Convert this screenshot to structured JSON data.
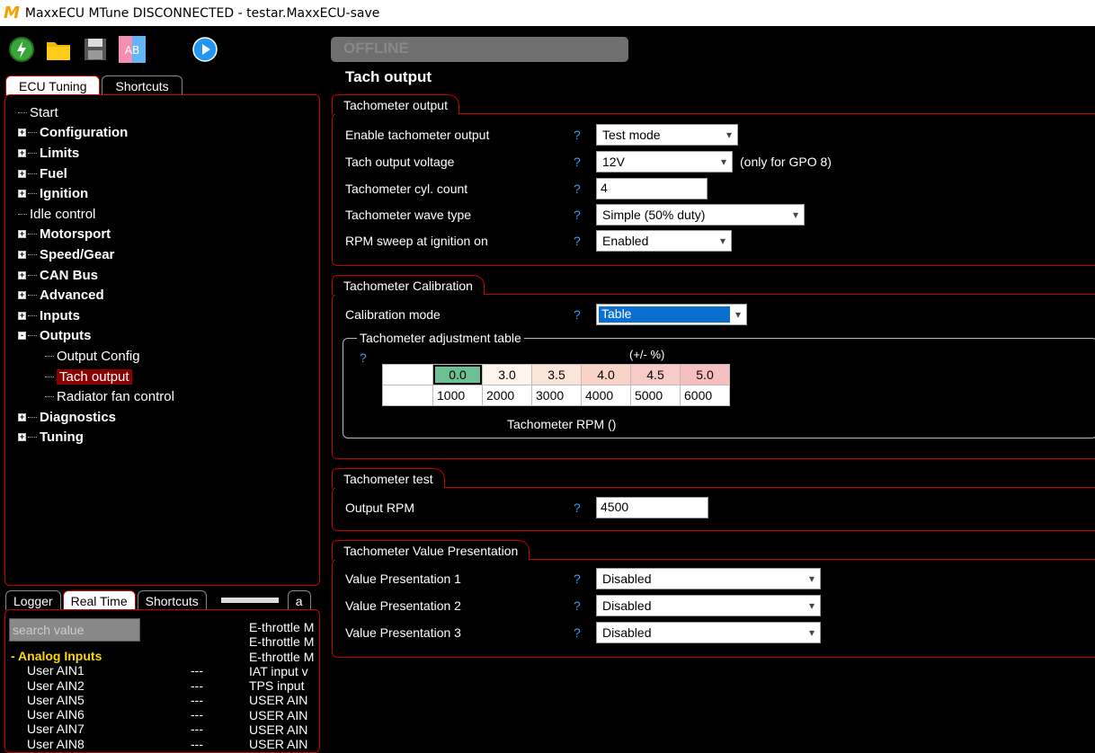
{
  "window": {
    "title": "MaxxECU MTune DISCONNECTED - testar.MaxxECU-save",
    "logo": "M"
  },
  "toolbar": {
    "icons": [
      "power-icon",
      "folder-icon",
      "save-icon",
      "compare-icon",
      "play-icon"
    ],
    "compare_label": "AB"
  },
  "left_tabs": [
    "ECU Tuning",
    "Shortcuts"
  ],
  "tree": [
    {
      "label": "Start",
      "bold": false,
      "expander": ""
    },
    {
      "label": "Configuration",
      "bold": true,
      "expander": "+"
    },
    {
      "label": "Limits",
      "bold": true,
      "expander": "+"
    },
    {
      "label": "Fuel",
      "bold": true,
      "expander": "+"
    },
    {
      "label": "Ignition",
      "bold": true,
      "expander": "+"
    },
    {
      "label": "Idle control",
      "bold": false,
      "expander": ""
    },
    {
      "label": "Motorsport",
      "bold": true,
      "expander": "+"
    },
    {
      "label": "Speed/Gear",
      "bold": true,
      "expander": "+"
    },
    {
      "label": "CAN Bus",
      "bold": true,
      "expander": "+"
    },
    {
      "label": "Advanced",
      "bold": true,
      "expander": "+"
    },
    {
      "label": "Inputs",
      "bold": true,
      "expander": "+"
    },
    {
      "label": "Outputs",
      "bold": true,
      "expander": "-"
    },
    {
      "label": "Output Config",
      "bold": false,
      "expander": "",
      "child": true
    },
    {
      "label": "Tach output",
      "bold": false,
      "expander": "",
      "child": true,
      "selected": true
    },
    {
      "label": "Radiator fan control",
      "bold": false,
      "expander": "",
      "child": true
    },
    {
      "label": "Diagnostics",
      "bold": true,
      "expander": "+"
    },
    {
      "label": "Tuning",
      "bold": true,
      "expander": "+"
    }
  ],
  "bottom_tabs": [
    "Logger",
    "Real Time",
    "Shortcuts",
    "a"
  ],
  "search": {
    "placeholder": "search value"
  },
  "realtime": {
    "group": "- Analog Inputs",
    "rows": [
      {
        "name": "User AIN1",
        "value": "---"
      },
      {
        "name": "User AIN2",
        "value": "---"
      },
      {
        "name": "User AIN5",
        "value": "---"
      },
      {
        "name": "User AIN6",
        "value": "---"
      },
      {
        "name": "User AIN7",
        "value": "---"
      },
      {
        "name": "User AIN8",
        "value": "---"
      }
    ],
    "right_col": [
      "E-throttle M",
      "E-throttle M",
      "E-throttle M",
      "IAT input v",
      "TPS input",
      "USER AIN",
      "USER AIN",
      "USER AIN",
      "USER AIN"
    ]
  },
  "status": {
    "offline": "OFFLINE"
  },
  "page_title": "Tach output",
  "tach_output": {
    "title": "Tachometer output",
    "enable": {
      "label": "Enable tachometer output",
      "value": "Test mode"
    },
    "voltage": {
      "label": "Tach output voltage",
      "value": "12V",
      "note": "(only for GPO 8)"
    },
    "cyl": {
      "label": "Tachometer cyl. count",
      "value": "4"
    },
    "wave": {
      "label": "Tachometer wave type",
      "value": "Simple (50% duty)"
    },
    "sweep": {
      "label": "RPM sweep at ignition on",
      "value": "Enabled"
    }
  },
  "calibration": {
    "title": "Tachometer Calibration",
    "mode": {
      "label": "Calibration mode",
      "value": "Table"
    },
    "table_title": "Tachometer adjustment table",
    "unit": "(+/- %)",
    "adjust": [
      "0.0",
      "3.0",
      "3.5",
      "4.0",
      "4.5",
      "5.0"
    ],
    "adjust_colors": [
      "#6fbf94",
      "#fdf4ee",
      "#fbe5d8",
      "#f9d4c6",
      "#f7cbc8",
      "#f5bfc0"
    ],
    "rpm": [
      "1000",
      "2000",
      "3000",
      "4000",
      "5000",
      "6000"
    ],
    "xlabel": "Tachometer RPM ()"
  },
  "test": {
    "title": "Tachometer test",
    "label": "Output RPM",
    "value": "4500"
  },
  "presentation": {
    "title": "Tachometer Value Presentation",
    "items": [
      {
        "label": "Value Presentation 1",
        "value": "Disabled"
      },
      {
        "label": "Value Presentation 2",
        "value": "Disabled"
      },
      {
        "label": "Value Presentation 3",
        "value": "Disabled"
      }
    ]
  },
  "help_mark": "?",
  "colors": {
    "accent_red": "#c40000",
    "selected": "#8b0000",
    "help": "#29a3ff",
    "group": "#ffd700"
  }
}
